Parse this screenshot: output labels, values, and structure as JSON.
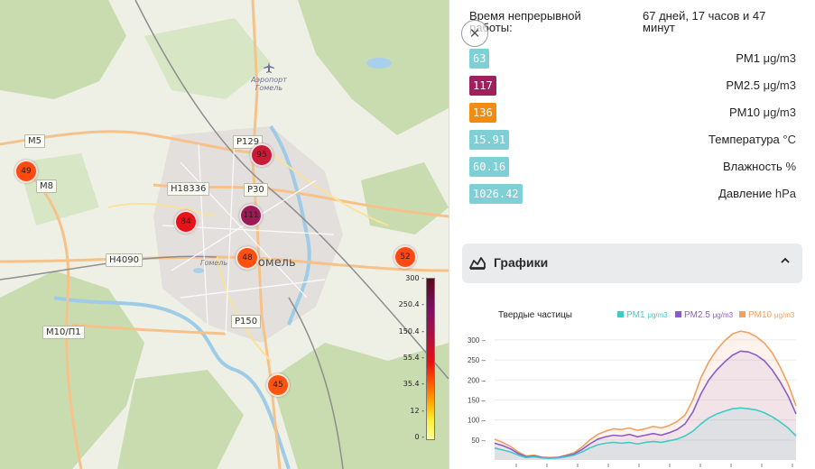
{
  "map": {
    "road_labels": [
      "M5",
      "M8",
      "H18336",
      "P129",
      "P30",
      "H4090",
      "M10/П1",
      "P150"
    ],
    "airport": "Аэропорт Гомель",
    "city": "Гомель",
    "city_small": "Гомель",
    "markers": [
      {
        "value": "49",
        "color": "#ff4a10"
      },
      {
        "value": "95",
        "color": "#c81b35"
      },
      {
        "value": "84",
        "color": "#e8121a"
      },
      {
        "value": "111",
        "color": "#9b1a55"
      },
      {
        "value": "48",
        "color": "#ff5010"
      },
      {
        "value": "52",
        "color": "#ff4812"
      },
      {
        "value": "45",
        "color": "#ff5410"
      }
    ],
    "legend_ticks": [
      "300 -",
      "250.4 -",
      "150.4 -",
      "55.4 -",
      "35.4 -",
      "12 -",
      "0 -"
    ]
  },
  "panel": {
    "uptime_label": "Время непрерывной работы:",
    "uptime_value": "67 дней, 17 часов и 47 минут",
    "metrics": [
      {
        "value": "63",
        "color": "#7ecfd6",
        "label": "PM1",
        "unit": "μg/m3"
      },
      {
        "value": "117",
        "color": "#a0205e",
        "label": "PM2.5",
        "unit": "μg/m3"
      },
      {
        "value": "136",
        "color": "#f08c12",
        "label": "PM10",
        "unit": "μg/m3"
      },
      {
        "value": "15.91",
        "color": "#7ecfd6",
        "label": "Температура",
        "unit": "°C"
      },
      {
        "value": "60.16",
        "color": "#7ecfd6",
        "label": "Влажность",
        "unit": "%"
      },
      {
        "value": "1026.42",
        "color": "#7ecfd6",
        "label": "Давление",
        "unit": "hPa"
      }
    ],
    "charts_title": "Графики",
    "icons": {
      "close": "close-icon",
      "chart": "area-chart-icon",
      "collapse": "chevron-up-icon"
    }
  },
  "chart_data": {
    "type": "area",
    "title": "Твердые частицы",
    "ylim": [
      0,
      320
    ],
    "yticks": [
      "300",
      "250",
      "200",
      "150",
      "100",
      "50"
    ],
    "legend_placement": "top-right",
    "grid": true,
    "series": [
      {
        "name": "PM1",
        "unit": "μg/m3",
        "color": "#3ecbc8",
        "values": [
          30,
          25,
          20,
          12,
          6,
          8,
          5,
          4,
          5,
          8,
          12,
          20,
          30,
          38,
          42,
          44,
          42,
          44,
          40,
          44,
          46,
          44,
          48,
          52,
          60,
          72,
          90,
          105,
          115,
          122,
          128,
          130,
          128,
          125,
          118,
          108,
          95,
          80,
          60
        ]
      },
      {
        "name": "PM2.5",
        "unit": "μg/m3",
        "color": "#8a5cc8",
        "values": [
          42,
          36,
          28,
          16,
          8,
          10,
          6,
          5,
          6,
          10,
          15,
          26,
          40,
          52,
          58,
          62,
          60,
          64,
          58,
          62,
          66,
          62,
          68,
          76,
          90,
          120,
          165,
          200,
          225,
          245,
          262,
          272,
          270,
          262,
          248,
          225,
          195,
          160,
          115
        ]
      },
      {
        "name": "PM10",
        "unit": "μg/m3",
        "color": "#f0a060",
        "values": [
          52,
          44,
          34,
          20,
          10,
          12,
          7,
          6,
          7,
          12,
          18,
          32,
          50,
          64,
          72,
          78,
          76,
          80,
          74,
          78,
          84,
          80,
          86,
          96,
          112,
          150,
          205,
          245,
          275,
          298,
          315,
          322,
          318,
          308,
          292,
          268,
          232,
          190,
          135
        ]
      }
    ]
  }
}
